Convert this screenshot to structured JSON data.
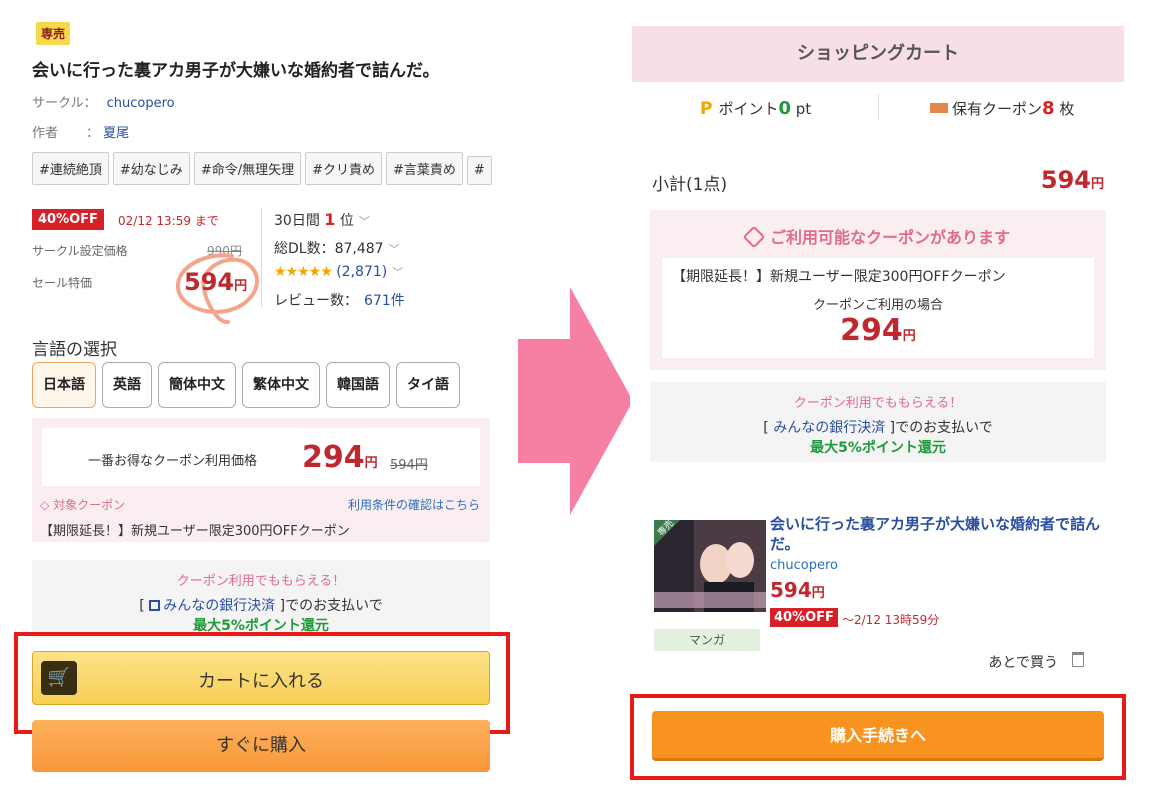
{
  "left": {
    "exclusive_badge": "専売",
    "title": "会いに行った裏アカ男子が大嫌いな婚約者で詰んだ。",
    "circle_label": "サークル：",
    "circle_name": "chucopero",
    "author_label": "作者",
    "author_sep": "：",
    "author_name": "夏尾",
    "tags": [
      "#連続絶頂",
      "#幼なじみ",
      "#命令/無理矢理",
      "#クリ責め",
      "#言葉責め",
      "#"
    ],
    "discount_badge": "40%OFF",
    "sale_until": "02/12 13:59 まで",
    "set_price_label": "サークル設定価格",
    "set_price": "990円",
    "sale_price_label": "セール特価",
    "sale_price": "594",
    "yen": "円",
    "rank_text": "30日間",
    "rank_num": "1",
    "rank_suffix": "位",
    "dl_text": "総DL数：87,487",
    "stars": "★★★★★",
    "rating_count": "(2,871)",
    "review_label": "レビュー数：",
    "review_count": "671件",
    "language_heading": "言語の選択",
    "languages": [
      "日本語",
      "英語",
      "簡体中文",
      "繁体中文",
      "韓国語",
      "タイ語"
    ],
    "coupon_label": "一番お得なクーポン利用価格",
    "coupon_price": "294",
    "coupon_strike": "594円",
    "target_coupon": "対象クーポン",
    "terms_link": "利用条件の確認はこちら",
    "coupon_name": "【期限延長！】新規ユーザー限定300円OFFクーポン",
    "bank_line1": "クーポン利用でももらえる！",
    "bank_open": "[",
    "bank_link": "みんなの銀行決済",
    "bank_after": "]でのお支払いで",
    "bank_line3": "最大5%ポイント還元",
    "cart_button": "カートに入れる",
    "buy_now_button": "すぐに購入"
  },
  "right": {
    "header": "ショッピングカート",
    "points_label": "ポイント",
    "points_value": "0",
    "points_unit": "pt",
    "coupons_label": "保有クーポン",
    "coupons_value": "8",
    "coupons_unit": "枚",
    "subtotal_label": "小計(1点)",
    "subtotal_value": "594",
    "yen": "円",
    "avail_head": "ご利用可能なクーポンがあります",
    "avail_name": "【期限延長！】新規ユーザー限定300円OFFクーポン",
    "avail_when": "クーポンご利用の場合",
    "avail_price": "294",
    "bank_line1": "クーポン利用でももらえる！",
    "bank_open": "[",
    "bank_link": "みんなの銀行決済",
    "bank_after": "]でのお支払いで",
    "bank_line3": "最大5%ポイント還元",
    "product_title": "会いに行った裏アカ男子が大嫌いな婚約者で詰んだ。",
    "product_circle": "chucopero",
    "product_price": "594",
    "product_off": "40%OFF",
    "product_until": "〜2/12 13時59分",
    "genre": "マンガ",
    "thumb_badge": "専売",
    "save_later": "あとで買う",
    "checkout_button": "購入手続きへ"
  },
  "colors": {
    "accent_red": "#c0282f",
    "pink": "#e06c8c",
    "green": "#1e9a3a",
    "orange": "#f7931e",
    "highlight_frame": "#e81b1b"
  }
}
